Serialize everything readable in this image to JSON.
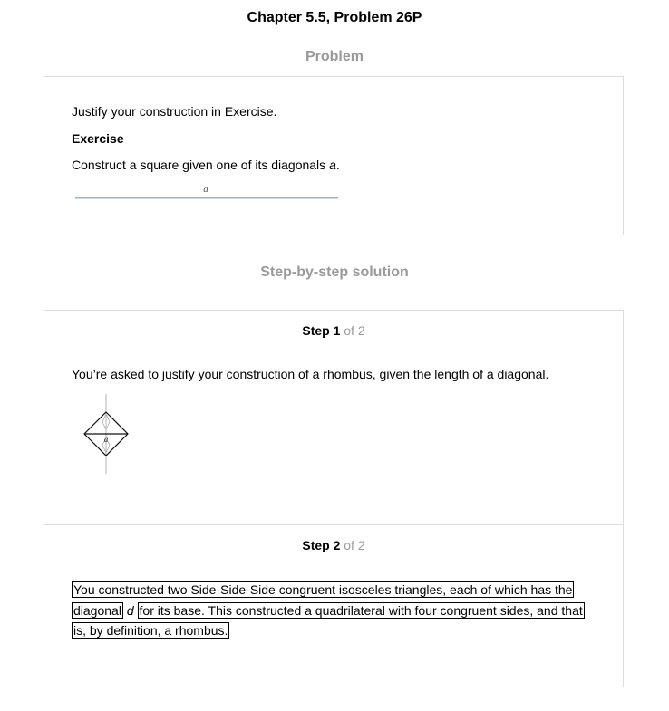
{
  "page": {
    "title": "Chapter 5.5, Problem 26P"
  },
  "problem": {
    "heading": "Problem",
    "intro": "Justify your construction in Exercise.",
    "exercise_label": "Exercise",
    "exercise_text_before": "Construct a square given one of its diagonals ",
    "exercise_variable": "a",
    "exercise_text_after": ".",
    "figure_label": "a"
  },
  "solution": {
    "heading": "Step-by-step solution",
    "steps": [
      {
        "label": "Step 1",
        "of_text": " of 2",
        "text": "You’re asked to justify your construction of a rhombus, given the length of a diagonal.",
        "figure_label": "a"
      },
      {
        "label": "Step 2",
        "of_text": " of 2",
        "segment_1": "You constructed two Side-Side-Side congruent isosceles triangles, each of which has the diagonal",
        "segment_2": "d",
        "segment_3": "for its base. This constructed a quadrilateral with four congruent sides, and that is, by definition, a rhombus."
      }
    ]
  }
}
